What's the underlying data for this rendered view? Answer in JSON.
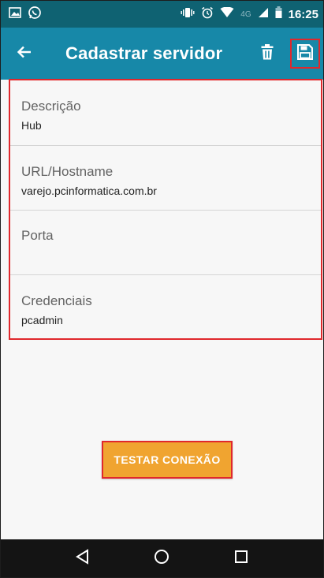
{
  "status_bar": {
    "time": "16:25",
    "network": "4G",
    "icons": [
      "image-icon",
      "whatsapp-icon",
      "vibrate-icon",
      "alarm-icon",
      "wifi-icon",
      "signal-icon",
      "battery-icon"
    ]
  },
  "app_bar": {
    "title": "Cadastrar servidor",
    "back_icon": "arrow-back-icon",
    "delete_icon": "trash-icon",
    "save_icon": "save-icon"
  },
  "form": {
    "fields": [
      {
        "label": "Descrição",
        "value": "Hub"
      },
      {
        "label": "URL/Hostname",
        "value": "varejo.pcinformatica.com.br"
      },
      {
        "label": "Porta",
        "value": ""
      },
      {
        "label": "Credenciais",
        "value": "pcadmin"
      }
    ]
  },
  "test_button": {
    "label": "TESTAR CONEXÃO"
  },
  "nav_bar": {
    "icons": [
      "back-triangle-icon",
      "home-circle-icon",
      "recents-square-icon"
    ]
  },
  "colors": {
    "status_bar": "#0f6272",
    "app_bar": "#1788a8",
    "accent_button": "#f0a430",
    "highlight": "#e0282c",
    "nav_bar": "#141414"
  }
}
